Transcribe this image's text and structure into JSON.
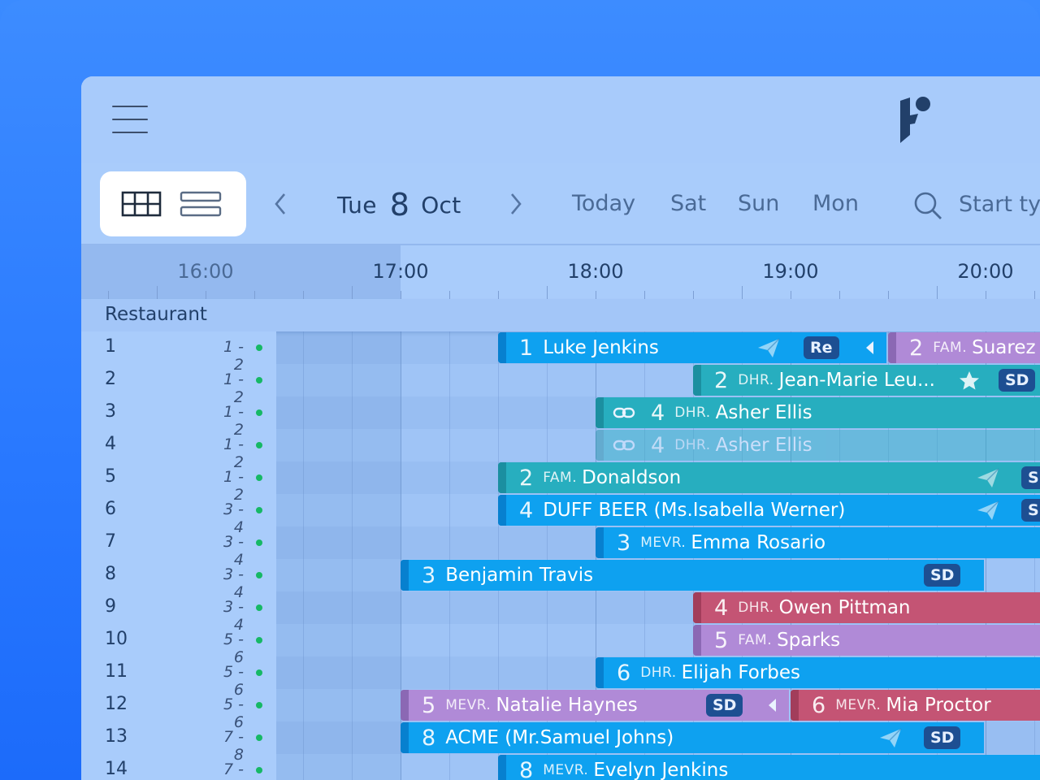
{
  "header": {
    "menu_icon": "hamburger-icon",
    "logo_icon": "brand-logo-icon"
  },
  "toolbar": {
    "view_grid_icon": "grid-view-icon",
    "view_list_icon": "list-view-icon",
    "date": {
      "weekday": "Tue",
      "day": "8",
      "month": "Oct"
    },
    "quick_days": [
      "Today",
      "Sat",
      "Sun",
      "Mon"
    ],
    "search_placeholder": "Start ty"
  },
  "timeline": {
    "hours": [
      "16:00",
      "17:00",
      "18:00",
      "19:00",
      "20:00"
    ]
  },
  "section_name": "Restaurant",
  "tables": [
    {
      "number": "1",
      "capacity": "1 - 2"
    },
    {
      "number": "2",
      "capacity": "1 - 2"
    },
    {
      "number": "3",
      "capacity": "1 - 2"
    },
    {
      "number": "4",
      "capacity": "1 - 2"
    },
    {
      "number": "5",
      "capacity": "1 - 2"
    },
    {
      "number": "6",
      "capacity": "3 - 4"
    },
    {
      "number": "7",
      "capacity": "3 - 4"
    },
    {
      "number": "8",
      "capacity": "3 - 4"
    },
    {
      "number": "9",
      "capacity": "3 - 4"
    },
    {
      "number": "10",
      "capacity": "5 - 6"
    },
    {
      "number": "11",
      "capacity": "5 - 6"
    },
    {
      "number": "12",
      "capacity": "5 - 6"
    },
    {
      "number": "13",
      "capacity": "7 - 8"
    },
    {
      "number": "14",
      "capacity": "7 - 8"
    }
  ],
  "reservations": [
    {
      "pax": "1",
      "title": "",
      "name": "Luke Jenkins",
      "badge": "Re"
    },
    {
      "pax": "2",
      "title": "FAM.",
      "name": "Suarez"
    },
    {
      "pax": "2",
      "title": "DHR.",
      "name": "Jean-Marie Leu...",
      "badge": "SD"
    },
    {
      "pax": "4",
      "title": "DHR.",
      "name": "Asher Ellis"
    },
    {
      "pax": "4",
      "title": "DHR.",
      "name": "Asher Ellis"
    },
    {
      "pax": "2",
      "title": "FAM.",
      "name": "Donaldson",
      "badge": "S"
    },
    {
      "pax": "4",
      "title": "",
      "name": "DUFF BEER (Ms.Isabella Werner)",
      "badge": "S"
    },
    {
      "pax": "3",
      "title": "MEVR.",
      "name": "Emma Rosario"
    },
    {
      "pax": "3",
      "title": "",
      "name": "Benjamin Travis",
      "badge": "SD"
    },
    {
      "pax": "4",
      "title": "DHR.",
      "name": "Owen Pittman"
    },
    {
      "pax": "5",
      "title": "FAM.",
      "name": "Sparks"
    },
    {
      "pax": "6",
      "title": "DHR.",
      "name": "Elijah Forbes"
    },
    {
      "pax": "5",
      "title": "MEVR.",
      "name": "Natalie Haynes",
      "badge": "SD"
    },
    {
      "pax": "6",
      "title": "MEVR.",
      "name": "Mia Proctor"
    },
    {
      "pax": "8",
      "title": "",
      "name": "ACME (Mr.Samuel Johns)",
      "badge": "SD"
    },
    {
      "pax": "8",
      "title": "MEVR.",
      "name": "Evelyn Jenkins"
    }
  ],
  "colors": {
    "accent_blue": "#0ea1f0",
    "teal": "#27aebf",
    "purple": "#b08ad7",
    "red": "#c45474",
    "status_green": "#16b865"
  }
}
